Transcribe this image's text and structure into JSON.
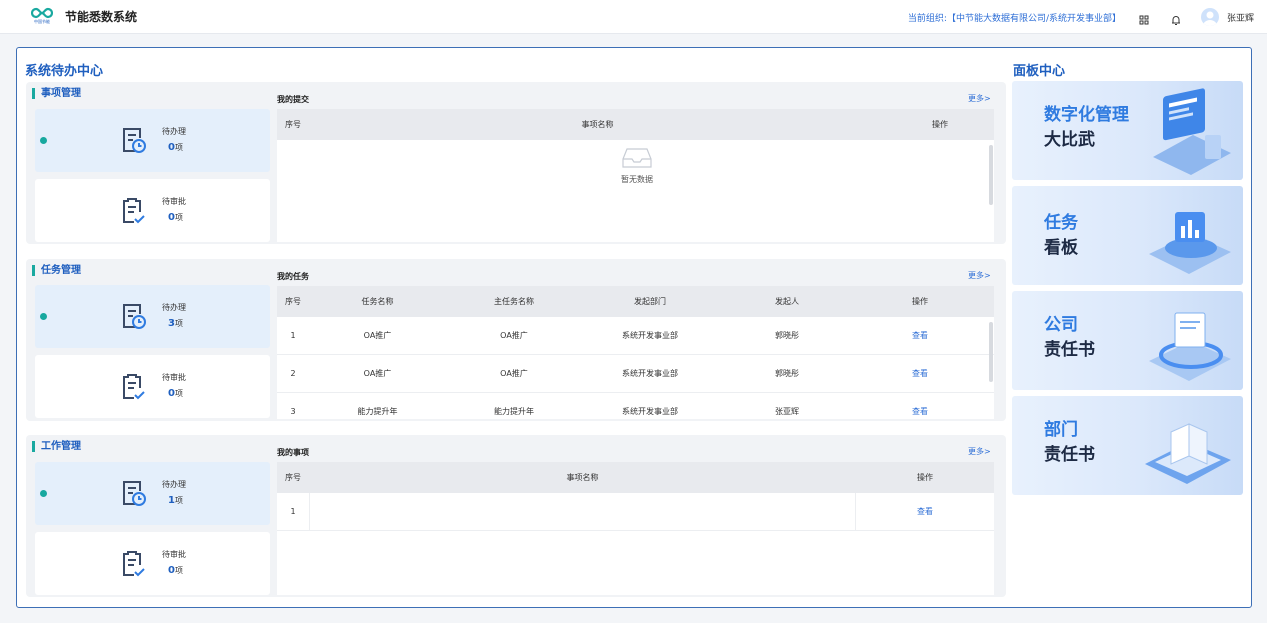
{
  "app": {
    "title": "节能悉数系统",
    "logo_subtext": "中国节能"
  },
  "header": {
    "org_label": "当前组织:【中节能大数据有限公司/系统开发事业部】",
    "user_name": "张亚辉"
  },
  "todo": {
    "title": "系统待办中心",
    "more_label": "更多>",
    "sections": [
      {
        "title": "事项管理",
        "cards": [
          {
            "label": "待办理",
            "count": "0",
            "unit": "项"
          },
          {
            "label": "待审批",
            "count": "0",
            "unit": "项"
          }
        ],
        "list_title": "我的提交",
        "columns": [
          "序号",
          "事项名称",
          "操作"
        ],
        "rows": [],
        "empty_text": "暂无数据"
      },
      {
        "title": "任务管理",
        "cards": [
          {
            "label": "待办理",
            "count": "3",
            "unit": "项"
          },
          {
            "label": "待审批",
            "count": "0",
            "unit": "项"
          }
        ],
        "list_title": "我的任务",
        "columns": [
          "序号",
          "任务名称",
          "主任务名称",
          "发起部门",
          "发起人",
          "操作"
        ],
        "rows": [
          {
            "no": "1",
            "task": "OA推广",
            "main_task": "OA推广",
            "dept": "系统开发事业部",
            "initiator": "郭晓彤",
            "action": "查看"
          },
          {
            "no": "2",
            "task": "OA推广",
            "main_task": "OA推广",
            "dept": "系统开发事业部",
            "initiator": "郭晓彤",
            "action": "查看"
          },
          {
            "no": "3",
            "task": "能力提升年",
            "main_task": "能力提升年",
            "dept": "系统开发事业部",
            "initiator": "张亚辉",
            "action": "查看"
          }
        ]
      },
      {
        "title": "工作管理",
        "cards": [
          {
            "label": "待办理",
            "count": "1",
            "unit": "项"
          },
          {
            "label": "待审批",
            "count": "0",
            "unit": "项"
          }
        ],
        "list_title": "我的事项",
        "columns": [
          "序号",
          "事项名称",
          "操作"
        ],
        "rows": [
          {
            "no": "1",
            "name": "",
            "action": "查看"
          }
        ]
      }
    ]
  },
  "panels": {
    "title": "面板中心",
    "items": [
      {
        "line1": "数字化管理",
        "line2": "大比武"
      },
      {
        "line1": "任务",
        "line2": "看板"
      },
      {
        "line1": "公司",
        "line2": "责任书"
      },
      {
        "line1": "部门",
        "line2": "责任书"
      }
    ]
  },
  "colors": {
    "accent": "#1f5fbf",
    "teal": "#17a89f",
    "link": "#2f6fd6"
  }
}
